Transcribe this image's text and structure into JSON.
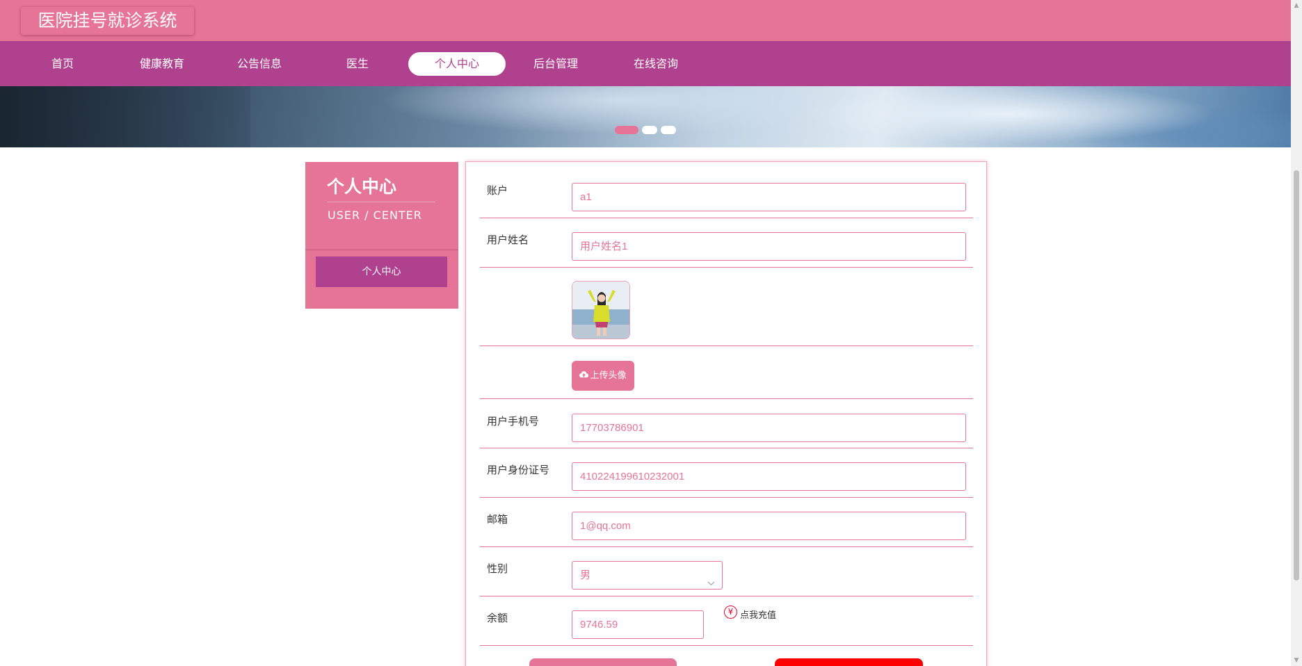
{
  "app": {
    "title": "医院挂号就诊系统"
  },
  "nav": {
    "items": [
      {
        "label": "首页"
      },
      {
        "label": "健康教育"
      },
      {
        "label": "公告信息"
      },
      {
        "label": "医生"
      },
      {
        "label": "个人中心",
        "active": true
      },
      {
        "label": "后台管理"
      },
      {
        "label": "在线咨询"
      }
    ]
  },
  "banner": {
    "slides": 3,
    "current_slide": 1
  },
  "sidebar": {
    "title": "个人中心",
    "subtitle": "USER / CENTER",
    "items": [
      {
        "label": "个人中心"
      }
    ]
  },
  "form": {
    "account": {
      "label": "账户",
      "value": "a1"
    },
    "name": {
      "label": "用户姓名",
      "value": "用户姓名1"
    },
    "avatar": {
      "icon": "user-photo"
    },
    "upload": {
      "label": "上传头像",
      "icon": "cloud-upload-icon"
    },
    "phone": {
      "label": "用户手机号",
      "value": "17703786901"
    },
    "id_card": {
      "label": "用户身份证号",
      "value": "410224199610232001"
    },
    "email": {
      "label": "邮箱",
      "value": "1@qq.com"
    },
    "gender": {
      "label": "性别",
      "value": "男"
    },
    "balance": {
      "label": "余额",
      "value": "9746.59",
      "recharge_label": "点我充值",
      "yen_symbol": "¥"
    }
  },
  "colors": {
    "primary": "#e57497",
    "nav": "#b0418f",
    "danger": "#ff0000"
  }
}
